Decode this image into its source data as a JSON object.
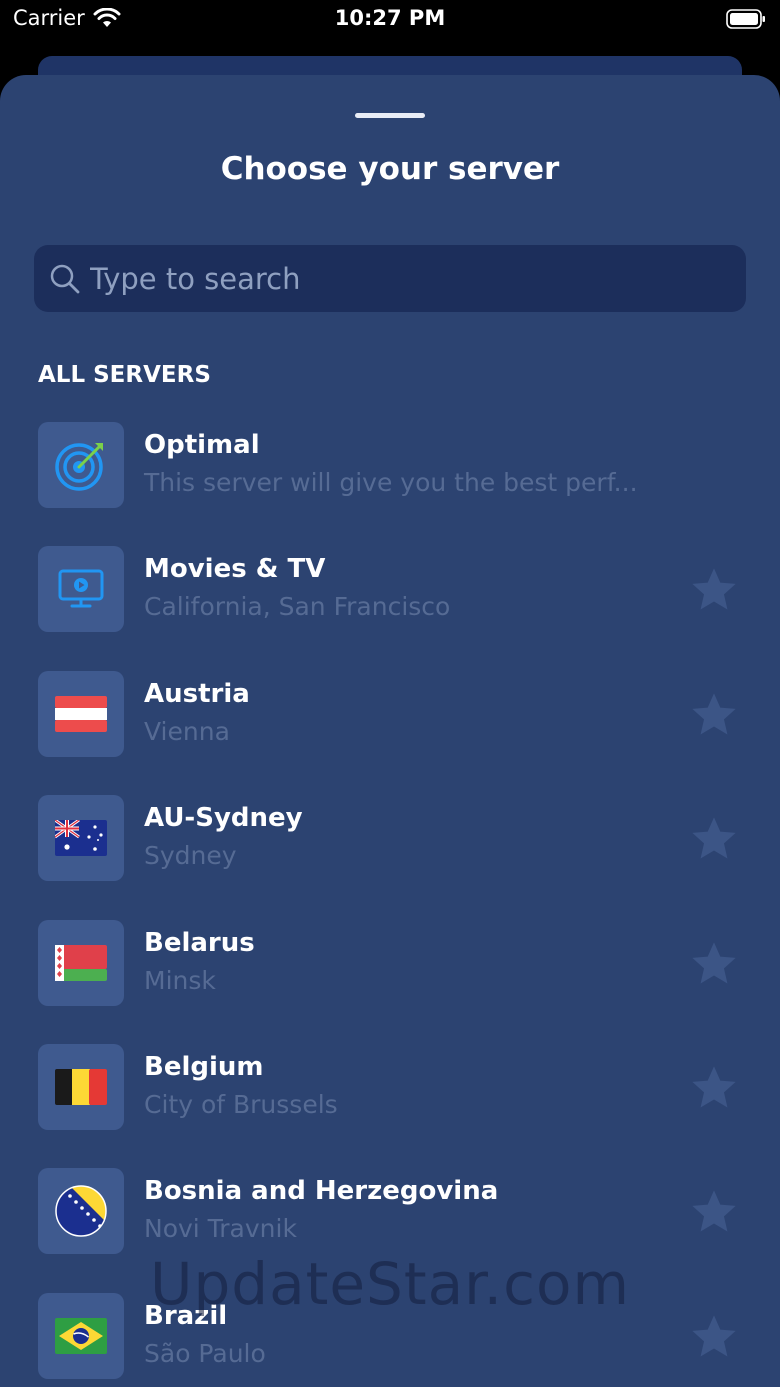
{
  "status_bar": {
    "carrier": "Carrier",
    "time": "10:27 PM"
  },
  "sheet": {
    "title": "Choose your server"
  },
  "search": {
    "placeholder": "Type to search"
  },
  "section": {
    "label": "ALL SERVERS"
  },
  "servers": [
    {
      "name": "Optimal",
      "subtitle": "This server will give you the best perf...",
      "icon": "target-icon",
      "favorite": false
    },
    {
      "name": "Movies & TV",
      "subtitle": "California, San Francisco",
      "icon": "tv-icon",
      "favorite": false
    },
    {
      "name": "Austria",
      "subtitle": "Vienna",
      "icon": "flag-austria-icon",
      "favorite": false
    },
    {
      "name": "AU-Sydney",
      "subtitle": "Sydney",
      "icon": "flag-australia-icon",
      "favorite": false
    },
    {
      "name": "Belarus",
      "subtitle": "Minsk",
      "icon": "flag-belarus-icon",
      "favorite": false
    },
    {
      "name": "Belgium",
      "subtitle": "City of Brussels",
      "icon": "flag-belgium-icon",
      "favorite": false
    },
    {
      "name": "Bosnia and Herzegovina",
      "subtitle": "Novi Travnik",
      "icon": "flag-bosnia-icon",
      "favorite": false
    },
    {
      "name": "Brazil",
      "subtitle": "São Paulo",
      "icon": "flag-brazil-icon",
      "favorite": false
    }
  ],
  "watermark": "UpdateStar.com",
  "colors": {
    "sheet_background": "#2c4371",
    "search_background": "#1c2e5b",
    "tile_background": "#3f5a8f",
    "accent_blue": "#2196f3",
    "star_inactive": "#3c5586",
    "subtitle_text": "#566b94"
  }
}
